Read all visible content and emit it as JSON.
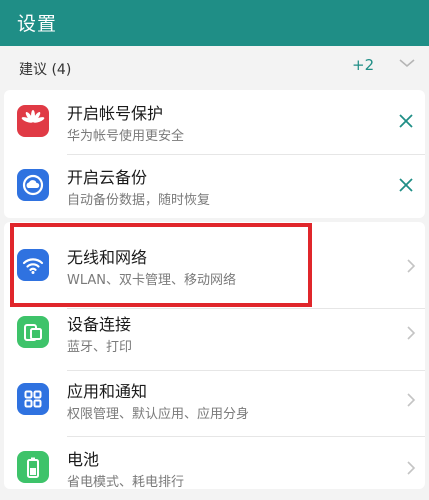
{
  "titlebar": {
    "title": "设置",
    "color": "#1f8e86"
  },
  "suggestions": {
    "header": "建议 (4)",
    "more_count": "+2",
    "expand_icon": "chevron-down-icon",
    "items": [
      {
        "name": "开启帐号保护",
        "desc": "华为帐号使用更安全",
        "icon": "huawei-logo-icon",
        "icon_color": "#e03a45",
        "action_icon": "close-icon"
      },
      {
        "name": "开启云备份",
        "desc": "自动备份数据，随时恢复",
        "icon": "cloud-backup-icon",
        "icon_color": "#2f72e0",
        "action_icon": "close-icon"
      }
    ]
  },
  "settings": {
    "items": [
      {
        "name": "无线和网络",
        "desc": "WLAN、双卡管理、移动网络",
        "icon": "wifi-icon",
        "icon_color": "#2f72e0"
      },
      {
        "name": "设备连接",
        "desc": "蓝牙、打印",
        "icon": "device-connection-icon",
        "icon_color": "#3ec36a"
      },
      {
        "name": "应用和通知",
        "desc": "权限管理、默认应用、应用分身",
        "icon": "apps-icon",
        "icon_color": "#2f72e0"
      },
      {
        "name": "电池",
        "desc": "省电模式、耗电排行",
        "icon": "battery-icon",
        "icon_color": "#3ec36a"
      }
    ]
  },
  "highlight_color": "#e0262b"
}
